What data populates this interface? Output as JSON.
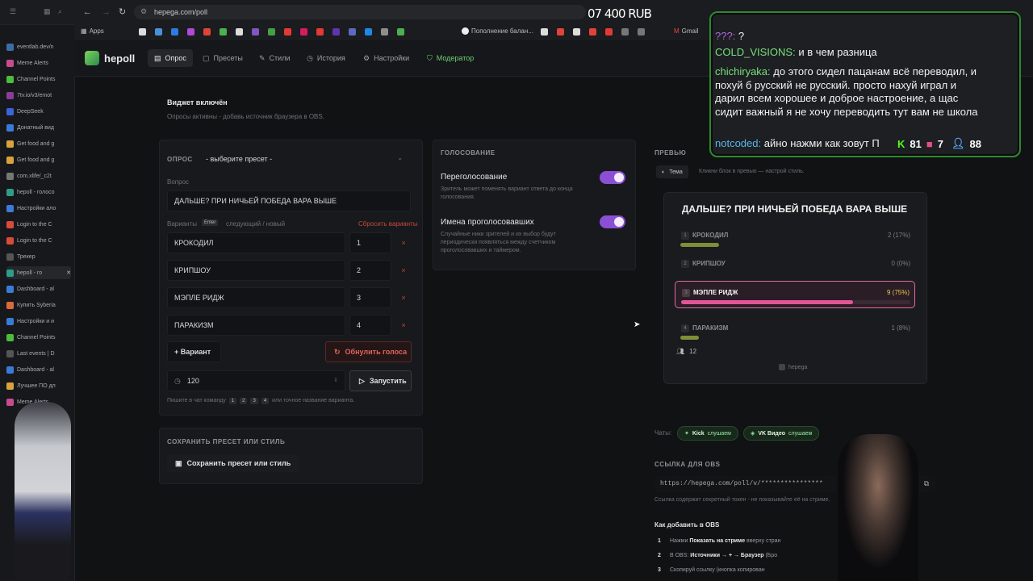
{
  "browser": {
    "url": "hepega.com/poll",
    "balance": "07 400 RUB",
    "bookmarks": [
      "Apps",
      "Пополнение балан...",
      "Gmail"
    ]
  },
  "sidebar_tabs": [
    {
      "label": "eventlab.dev/n",
      "color": "#3b6ea8"
    },
    {
      "label": "Meme Alerts",
      "color": "#c74b8f"
    },
    {
      "label": "Channel Points",
      "color": "#4dbb3c"
    },
    {
      "label": "7tv.io/v3/emot",
      "color": "#8a3c9c"
    },
    {
      "label": "DeepSeek",
      "color": "#3c63d8"
    },
    {
      "label": "Донатный вид",
      "color": "#3c7ad8"
    },
    {
      "label": "Get food and g",
      "color": "#d8a23c"
    },
    {
      "label": "Get food and g",
      "color": "#d8a23c"
    },
    {
      "label": "com.xlife/_c2t",
      "color": "#777777"
    },
    {
      "label": "hepoll - голосо",
      "color": "#2f9c8a"
    },
    {
      "label": "Настройки ало",
      "color": "#3c7ad8"
    },
    {
      "label": "Login to the C",
      "color": "#d84b3c"
    },
    {
      "label": "Login to the C",
      "color": "#d84b3c"
    },
    {
      "label": "Трекер",
      "color": "#555555"
    },
    {
      "label": "hepoll - го",
      "color": "#2f9c8a"
    },
    {
      "label": "Dashboard - al",
      "color": "#3c7ad8"
    },
    {
      "label": "Купить Syberia",
      "color": "#d86b3c"
    },
    {
      "label": "Настройки и и",
      "color": "#3c7ad8"
    },
    {
      "label": "Channel Points",
      "color": "#4dbb3c"
    },
    {
      "label": "Last events | D",
      "color": "#555555"
    },
    {
      "label": "Dashboard - al",
      "color": "#3c7ad8"
    },
    {
      "label": "Лучшее ПО дл",
      "color": "#d8a23c"
    },
    {
      "label": "Meme Alerts",
      "color": "#c74b8f"
    }
  ],
  "app": {
    "logo": "hepoll",
    "nav": [
      "Опрос",
      "Пресеты",
      "Стили",
      "История",
      "Настройки",
      "Модератор"
    ]
  },
  "widget": {
    "title": "Виджет включён",
    "subtitle": "Опросы активны - добавь источник браузера в OBS."
  },
  "poll": {
    "label": "ОПРОС",
    "preset_select": "- выберите пресет -",
    "question_label": "Вопрос",
    "question": "ДАЛЬШЕ? ПРИ НИЧЬЕЙ ПОБЕДА ВАРА ВЫШЕ",
    "variants_label": "Варианты",
    "enter_key": "Enter",
    "variants_hint": "следующий / новый",
    "reset_variants": "Сбросить варианты",
    "options": [
      {
        "name": "КРОКОДИЛ",
        "num": "1"
      },
      {
        "name": "КРИПШОУ",
        "num": "2"
      },
      {
        "name": "МЭПЛЕ РИДЖ",
        "num": "3"
      },
      {
        "name": "ПАРАКИЗМ",
        "num": "4"
      }
    ],
    "add_variant": "+ Вариант",
    "reset_votes": "Обнулить голоса",
    "timer": "120",
    "start": "Запустить",
    "hint_prefix": "Пишите в чат команду",
    "hint_keys": [
      "1",
      "2",
      "3",
      "4"
    ],
    "hint_suffix": "или точное название варианта."
  },
  "save": {
    "label": "СОХРАНИТЬ ПРЕСЕТ ИЛИ СТИЛЬ",
    "button": "Сохранить пресет или стиль"
  },
  "voting": {
    "label": "ГОЛОСОВАНИЕ",
    "revote_title": "Переголосование",
    "revote_desc": "Зритель может поменять вариант ответа до конца голосования.",
    "revote_on": true,
    "names_title": "Имена проголосовавших",
    "names_desc": "Случайные ники зрителей и их выбор будут периодически появляться между счетчиком проголосовавших и таймером.",
    "names_on": true
  },
  "preview": {
    "label": "ПРЕВЬЮ",
    "theme_tab": "Тема",
    "theme_hint": "Кликни блок в превью — настрой стиль.",
    "question": "ДАЛЬШЕ? ПРИ НИЧЬЕЙ ПОБЕДА ВАРА ВЫШЕ",
    "options": [
      {
        "num": "1",
        "name": "КРОКОДИЛ",
        "value": "2 (17%)",
        "percent": 17,
        "color": "#7e8f38",
        "active": false
      },
      {
        "num": "2",
        "name": "КРИПШОУ",
        "value": "0 (0%)",
        "percent": 0,
        "color": "#7e8f38",
        "active": false
      },
      {
        "num": "3",
        "name": "МЭПЛЕ РИДЖ",
        "value": "9 (75%)",
        "percent": 75,
        "color": "#e25596",
        "active": true
      },
      {
        "num": "4",
        "name": "ПАРАКИЗМ",
        "value": "1 (8%)",
        "percent": 8,
        "color": "#7e8f38",
        "active": false
      }
    ],
    "voters": "12",
    "brand": "hepega"
  },
  "chats": {
    "label": "Чаты:",
    "kick": "Kick",
    "kick_status": "слушаем",
    "vk": "VK Видео",
    "vk_status": "слушаем"
  },
  "obs": {
    "label": "ССЫЛКА ДЛЯ OBS",
    "url": "https://hepega.com/poll/v/****************",
    "note": "Ссылка содержит секретный токен - не показывайте её на стриме.",
    "howto": "Как добавить в OBS",
    "steps": [
      {
        "n": "1",
        "pre": "Нажми ",
        "bold": "Показать на стриме",
        "post": " вверху стран"
      },
      {
        "n": "2",
        "pre": "В OBS: ",
        "bold": "Источники → + → Браузер",
        "post": " (Бро"
      },
      {
        "n": "3",
        "pre": "Скопируй ссылку (кнопка копирован",
        "bold": "",
        "post": ""
      }
    ]
  },
  "chat_overlay": {
    "lines": [
      {
        "nick": "???:",
        "text": " ?"
      },
      {
        "nick": "COLD_VISIONS:",
        "text": " и в чем разница"
      },
      {
        "nick": "chichiryaka:",
        "text": " до этого сидел пацанам всё переводил, и"
      },
      {
        "nick": "",
        "text": "похуй б   русский не русский. просто нахуй играл и"
      },
      {
        "nick": "",
        "text": "дарил всем хорошее и доброе настроение, а щас"
      },
      {
        "nick": "",
        "text": "сидит важный я не хочу переводить тут вам не школа"
      },
      {
        "nick": "notcoded:",
        "text": " айно нажми как зовут П"
      }
    ],
    "kick_count": "81",
    "vk_count": "7",
    "viewers": "88"
  }
}
